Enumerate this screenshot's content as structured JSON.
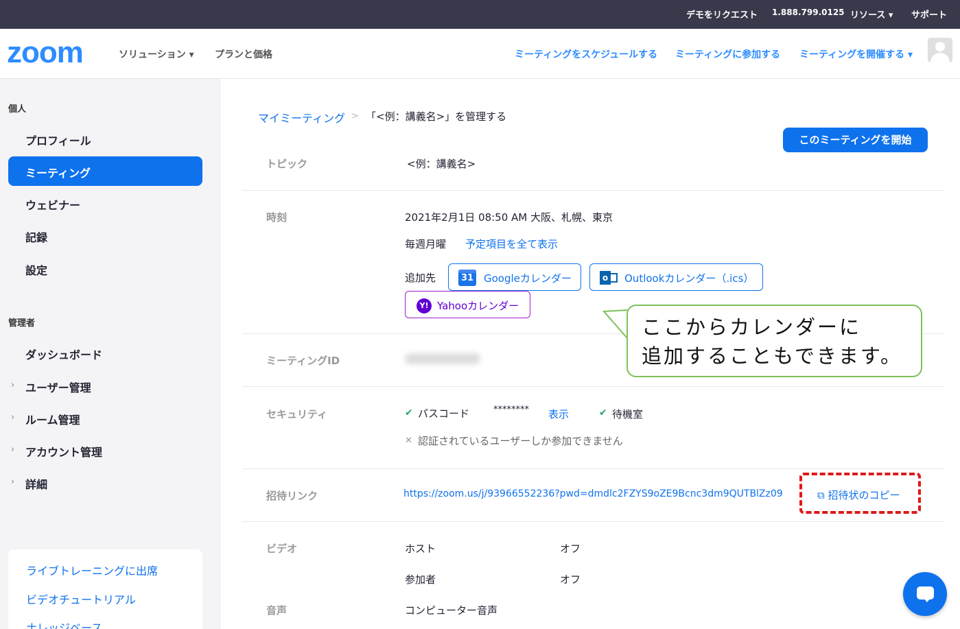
{
  "topbar": {
    "request_demo": "デモをリクエスト",
    "phone": "1.888.799.0125",
    "resources": "リソース",
    "support": "サポート"
  },
  "nav": {
    "logo": "zoom",
    "solutions": "ソリューション",
    "plans": "プランと価格",
    "schedule": "ミーティングをスケジュールする",
    "join": "ミーティングに参加する",
    "host": "ミーティングを開催する"
  },
  "sidebar": {
    "personal_header": "個人",
    "items": [
      "プロフィール",
      "ミーティング",
      "ウェビナー",
      "記録",
      "設定"
    ],
    "admin_header": "管理者",
    "admin_items": [
      "ダッシュボード",
      "ユーザー管理",
      "ルーム管理",
      "アカウント管理",
      "詳細"
    ],
    "links": [
      "ライブトレーニングに出席",
      "ビデオチュートリアル",
      "ナレッジベース"
    ]
  },
  "breadcrumb": {
    "parent": "マイミーティング",
    "separator": ">",
    "current": "「<例：講義名>」を管理する"
  },
  "start_button": "このミーティングを開始",
  "meeting": {
    "topic_label": "トピック",
    "topic_value": "<例：講義名>",
    "time_label": "時刻",
    "time_value": "2021年2月1日 08:50 AM 大阪、札幌、東京",
    "recurrence": "毎週月曜",
    "show_all": "予定項目を全て表示",
    "add_to_label": "追加先",
    "google_calendar": "Googleカレンダー",
    "google_icon_text": "31",
    "outlook_calendar": "Outlookカレンダー（.ics）",
    "outlook_icon_text": "o",
    "yahoo_calendar": "Yahooカレンダー",
    "yahoo_icon_text": "Y!",
    "meeting_id_label": "ミーティングID",
    "security_label": "セキュリティ",
    "passcode_label": "パスコード",
    "passcode_mask": "********",
    "show_passcode": "表示",
    "waiting_room": "待機室",
    "auth_only": "認証されているユーザーしか参加できません",
    "invite_link_label": "招待リンク",
    "invite_link": "https://zoom.us/j/93966552236?pwd=dmdlc2FZYS9oZE9Bcnc3dm9QUTBlZz09",
    "copy_invitation": "招待状のコピー",
    "video_label": "ビデオ",
    "host_label": "ホスト",
    "host_video": "オフ",
    "participant_label": "参加者",
    "participant_video": "オフ",
    "audio_label": "音声",
    "audio_value": "コンピューター音声"
  },
  "callout": {
    "line1": "ここからカレンダーに",
    "line2": "追加することもできます。"
  },
  "colors": {
    "zoom_blue": "#0e72ed",
    "topbar_bg": "#383a4b",
    "callout_border": "#7dc05a",
    "highlight_red": "#e01818"
  }
}
